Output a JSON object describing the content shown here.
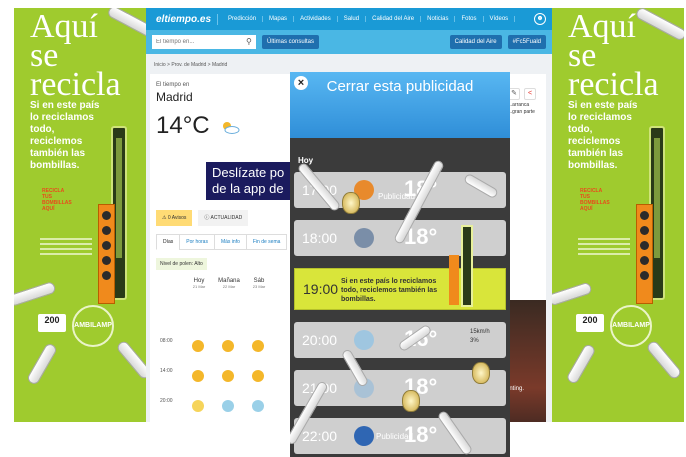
{
  "ad": {
    "title_lines": [
      "Aquí",
      "se",
      "recicla"
    ],
    "copy_lines": [
      "Si en este país",
      "lo reciclamos",
      "todo,",
      "reciclemos",
      "también las",
      "bombillas."
    ],
    "recicla_lines": [
      "RECICLA",
      "TUS",
      "BOMBILLAS",
      "AQUÍ"
    ],
    "badge": "200",
    "brand": "AMBILAMP"
  },
  "site": {
    "logo": "eltiempo.es",
    "nav": [
      "Predicción",
      "Mapas",
      "Actividades",
      "Salud",
      "Calidad del Aire",
      "Noticias",
      "Fotos",
      "Vídeos"
    ],
    "search_placeholder": "El tiempo en...",
    "recent_label": "Últimas consultas",
    "air_quality_button": "Calidad del Aire",
    "hashtag_button": "#Fc5Fuald",
    "breadcrumb": "Inicio > Prov. de Madrid > Madrid",
    "location_small": "El tiempo en",
    "city": "Madrid",
    "temperature": "14°C",
    "side_text": [
      "...arranca",
      "...gran parte"
    ],
    "banner_lines": [
      "Deslízate po",
      "de la app de"
    ],
    "alerts_label": "0 Avisos",
    "actual_label": "ACTUALIDAD",
    "tabs": [
      "Días",
      "Por horas",
      "Más info",
      "Fin de sema"
    ],
    "pollen": "Nivel de polen: Alto",
    "days": [
      {
        "name": "Hoy",
        "date": "21 Mar"
      },
      {
        "name": "Mañana",
        "date": "22 Mar"
      },
      {
        "name": "Sáb",
        "date": "23 Mar"
      }
    ],
    "hours": [
      "08:00",
      "14:00",
      "20:00"
    ],
    "photo_caption": "enting."
  },
  "phone": {
    "close_label": "Cerrar esta publicidad",
    "today": "Hoy",
    "publicidad": "Publicidad",
    "rows": [
      {
        "time": "17:00",
        "temp": "18°"
      },
      {
        "time": "18:00",
        "temp": "18°"
      },
      {
        "time": "20:00",
        "temp": "16°"
      },
      {
        "time": "21:00",
        "temp": "18°"
      },
      {
        "time": "22:00",
        "temp": "18°"
      }
    ],
    "promo_time": "19:00",
    "promo_lines": [
      "Si en este país lo reciclamos",
      "todo, reciclemos también las",
      "bombillas."
    ],
    "wind": [
      "15km/h",
      "3%"
    ]
  },
  "colors": {
    "ad_green": "#9fcb2e",
    "site_blue": "#1a9ad6",
    "promo_yellow": "#d9e53a",
    "banner_navy": "#1b1b5e"
  }
}
